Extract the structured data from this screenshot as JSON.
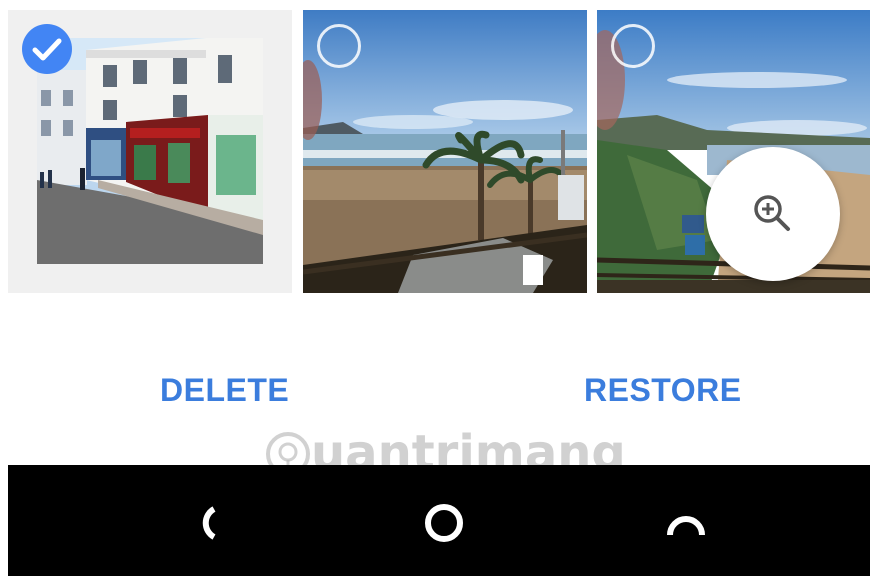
{
  "grid": {
    "photos": [
      {
        "name": "street-shop-photo",
        "selected": true
      },
      {
        "name": "beach-palms-photo",
        "selected": false
      },
      {
        "name": "coast-hillside-photo",
        "selected": false
      }
    ],
    "zoom_icon": "zoom-in-icon"
  },
  "actions": {
    "delete_label": "DELETE",
    "restore_label": "RESTORE"
  },
  "watermark": {
    "text": "uantrimang"
  },
  "navbar": {
    "icons": [
      "back-icon",
      "home-icon",
      "recents-icon"
    ]
  },
  "colors": {
    "accent": "#4285f4",
    "action_text": "#3b7ddd",
    "navbar": "#000000"
  }
}
